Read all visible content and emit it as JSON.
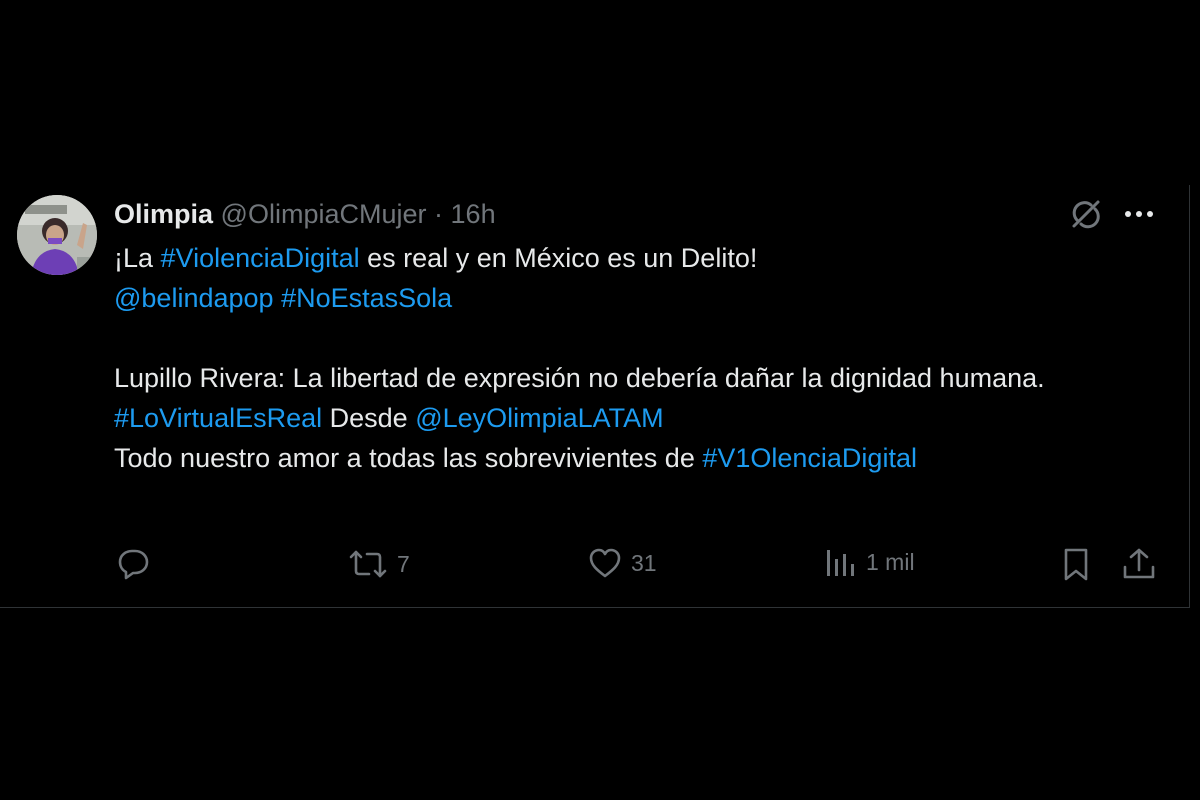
{
  "tweet": {
    "author": {
      "name": "Olimpia",
      "handle": "@OlimpiaCMujer",
      "separator": "·",
      "time": "16h"
    },
    "lines": {
      "l1_a": "¡La ",
      "l1_tag": "#ViolenciaDigital",
      "l1_b": " es real y en México es un Delito!",
      "l2_mention": "@belindapop",
      "l2_space": " ",
      "l2_tag": "#NoEstasSola",
      "l3": "Lupillo Rivera: La libertad de expresión no debería dañar la dignidad humana.",
      "l4_tag": "#LoVirtualEsReal",
      "l4_mid": " Desde ",
      "l4_mention": "@LeyOlimpiaLATAM",
      "l5_a": "Todo nuestro amor a todas las sobrevivientes de ",
      "l5_tag": "#V1OlenciaDigital"
    },
    "stats": {
      "reposts": "7",
      "likes": "31",
      "views": "1 mil"
    },
    "icons": {
      "grok": "grok-icon",
      "more": "more-icon",
      "reply": "reply-icon",
      "repost": "repost-icon",
      "like": "heart-icon",
      "views": "views-icon",
      "bookmark": "bookmark-icon",
      "share": "share-icon"
    },
    "colors": {
      "background": "#000000",
      "text": "#e7e9ea",
      "muted": "#71767b",
      "link": "#1d9bf0",
      "border": "#2f3336"
    }
  }
}
